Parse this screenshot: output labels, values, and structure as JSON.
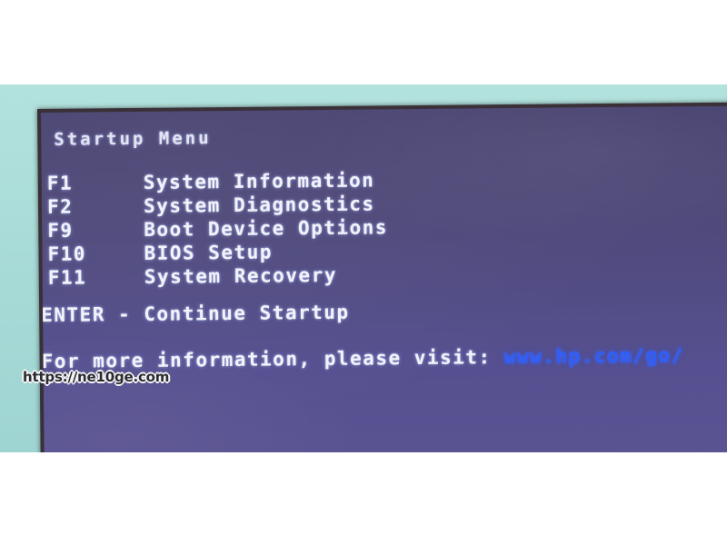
{
  "screen": {
    "title": "Startup Menu",
    "menu_items": [
      {
        "key": "F1",
        "label": "System Information"
      },
      {
        "key": "F2",
        "label": "System Diagnostics"
      },
      {
        "key": "F9",
        "label": "Boot Device Options"
      },
      {
        "key": "F10",
        "label": "BIOS Setup"
      },
      {
        "key": "F11",
        "label": "System Recovery"
      }
    ],
    "enter_line": "ENTER - Continue Startup",
    "info_prefix": "For more information, please visit: ",
    "info_url": "www.hp.com/go/",
    "colors": {
      "screen_background": "#4e4878",
      "text": "#f2f2fa",
      "url": "#2f5ef7",
      "surround": "#a8ddd9",
      "bezel": "#3a3038"
    }
  },
  "watermark": {
    "text": "https://ne10ge.com"
  }
}
